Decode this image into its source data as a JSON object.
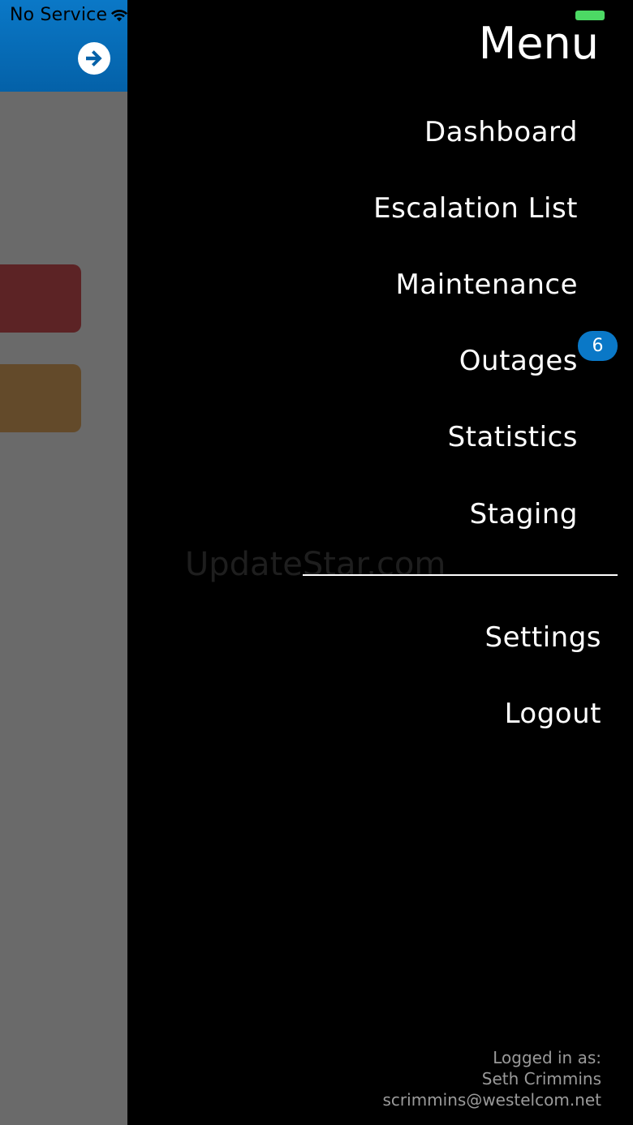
{
  "status_bar": {
    "carrier": "No Service",
    "wifi_icon": "wifi-icon",
    "battery_icon": "battery-icon",
    "battery_color": "#4cd964"
  },
  "background_app": {
    "header_color": "#0a78c7",
    "action_icon": "arrow-right-circle-icon",
    "card_colors": [
      "#5c2325",
      "#634a2a"
    ]
  },
  "menu": {
    "title": "Menu",
    "items": [
      {
        "label": "Dashboard"
      },
      {
        "label": "Escalation List"
      },
      {
        "label": "Maintenance"
      },
      {
        "label": "Outages",
        "badge": "6"
      },
      {
        "label": "Statistics"
      },
      {
        "label": "Staging"
      }
    ],
    "secondary_items": [
      {
        "label": "Settings"
      },
      {
        "label": "Logout"
      }
    ],
    "badge_color": "#0a78c7"
  },
  "watermark": "UpdateStar.com",
  "footer": {
    "logged_in_label": "Logged in as:",
    "user_name": "Seth Crimmins",
    "user_email": "scrimmins@westelcom.net"
  }
}
